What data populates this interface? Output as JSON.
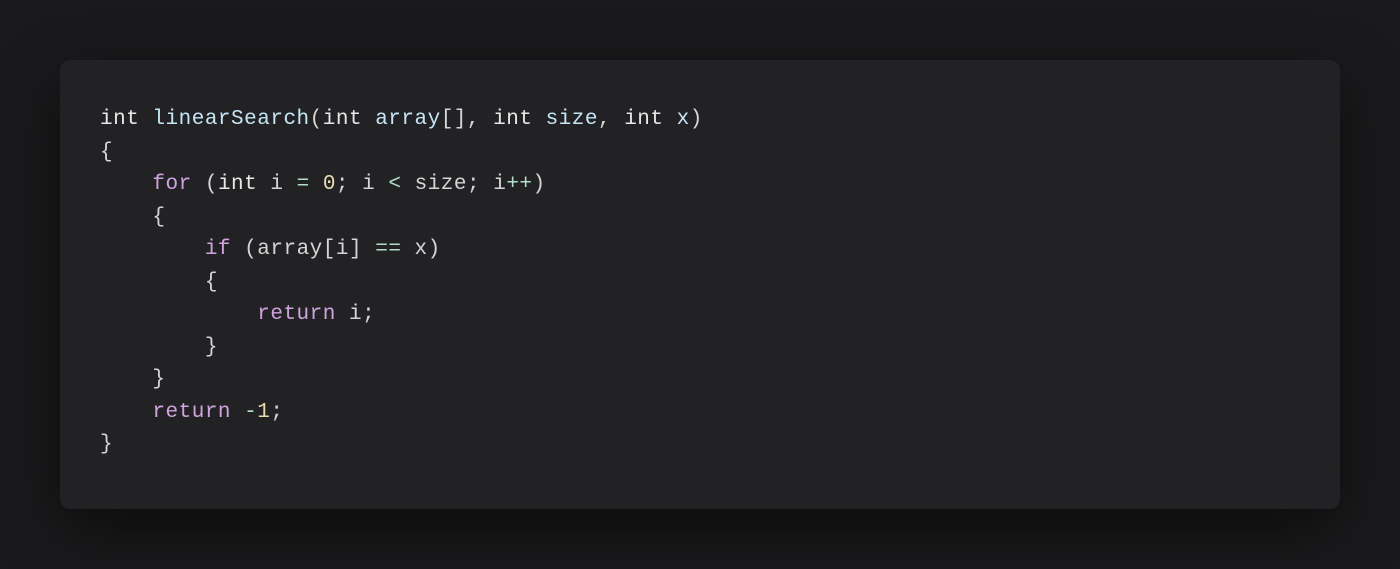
{
  "code": {
    "language": "c",
    "function_name": "linearSearch",
    "lines": [
      [
        {
          "c": "tk-type",
          "t": "int"
        },
        {
          "c": "sp",
          "t": " "
        },
        {
          "c": "tk-func",
          "t": "linearSearch"
        },
        {
          "c": "tk-punct",
          "t": "("
        },
        {
          "c": "tk-type",
          "t": "int"
        },
        {
          "c": "sp",
          "t": " "
        },
        {
          "c": "tk-param",
          "t": "array"
        },
        {
          "c": "tk-punct",
          "t": "[]"
        },
        {
          "c": "tk-punct",
          "t": ","
        },
        {
          "c": "sp",
          "t": " "
        },
        {
          "c": "tk-type",
          "t": "int"
        },
        {
          "c": "sp",
          "t": " "
        },
        {
          "c": "tk-param",
          "t": "size"
        },
        {
          "c": "tk-punct",
          "t": ","
        },
        {
          "c": "sp",
          "t": " "
        },
        {
          "c": "tk-type",
          "t": "int"
        },
        {
          "c": "sp",
          "t": " "
        },
        {
          "c": "tk-param",
          "t": "x"
        },
        {
          "c": "tk-punct",
          "t": ")"
        }
      ],
      [
        {
          "c": "tk-punct",
          "t": "{"
        }
      ],
      [
        {
          "c": "sp",
          "t": "    "
        },
        {
          "c": "tk-kw",
          "t": "for"
        },
        {
          "c": "sp",
          "t": " "
        },
        {
          "c": "tk-punct",
          "t": "("
        },
        {
          "c": "tk-type",
          "t": "int"
        },
        {
          "c": "sp",
          "t": " "
        },
        {
          "c": "tk-ident",
          "t": "i"
        },
        {
          "c": "sp",
          "t": " "
        },
        {
          "c": "tk-op",
          "t": "="
        },
        {
          "c": "sp",
          "t": " "
        },
        {
          "c": "tk-num",
          "t": "0"
        },
        {
          "c": "tk-punct",
          "t": ";"
        },
        {
          "c": "sp",
          "t": " "
        },
        {
          "c": "tk-ident",
          "t": "i"
        },
        {
          "c": "sp",
          "t": " "
        },
        {
          "c": "tk-op",
          "t": "<"
        },
        {
          "c": "sp",
          "t": " "
        },
        {
          "c": "tk-ident",
          "t": "size"
        },
        {
          "c": "tk-punct",
          "t": ";"
        },
        {
          "c": "sp",
          "t": " "
        },
        {
          "c": "tk-ident",
          "t": "i"
        },
        {
          "c": "tk-op",
          "t": "++"
        },
        {
          "c": "tk-punct",
          "t": ")"
        }
      ],
      [
        {
          "c": "sp",
          "t": "    "
        },
        {
          "c": "tk-punct",
          "t": "{"
        }
      ],
      [
        {
          "c": "sp",
          "t": "        "
        },
        {
          "c": "tk-kw",
          "t": "if"
        },
        {
          "c": "sp",
          "t": " "
        },
        {
          "c": "tk-punct",
          "t": "("
        },
        {
          "c": "tk-ident",
          "t": "array"
        },
        {
          "c": "tk-punct",
          "t": "["
        },
        {
          "c": "tk-ident",
          "t": "i"
        },
        {
          "c": "tk-punct",
          "t": "]"
        },
        {
          "c": "sp",
          "t": " "
        },
        {
          "c": "tk-op",
          "t": "=="
        },
        {
          "c": "sp",
          "t": " "
        },
        {
          "c": "tk-ident",
          "t": "x"
        },
        {
          "c": "tk-punct",
          "t": ")"
        }
      ],
      [
        {
          "c": "sp",
          "t": "        "
        },
        {
          "c": "tk-punct",
          "t": "{"
        }
      ],
      [
        {
          "c": "sp",
          "t": "            "
        },
        {
          "c": "tk-kw",
          "t": "return"
        },
        {
          "c": "sp",
          "t": " "
        },
        {
          "c": "tk-ident",
          "t": "i"
        },
        {
          "c": "tk-punct",
          "t": ";"
        }
      ],
      [
        {
          "c": "sp",
          "t": "        "
        },
        {
          "c": "tk-punct",
          "t": "}"
        }
      ],
      [
        {
          "c": "sp",
          "t": "    "
        },
        {
          "c": "tk-punct",
          "t": "}"
        }
      ],
      [
        {
          "c": "sp",
          "t": "    "
        },
        {
          "c": "tk-kw",
          "t": "return"
        },
        {
          "c": "sp",
          "t": " "
        },
        {
          "c": "tk-op",
          "t": "-"
        },
        {
          "c": "tk-num",
          "t": "1"
        },
        {
          "c": "tk-punct",
          "t": ";"
        }
      ],
      [
        {
          "c": "tk-punct",
          "t": "}"
        }
      ]
    ]
  }
}
